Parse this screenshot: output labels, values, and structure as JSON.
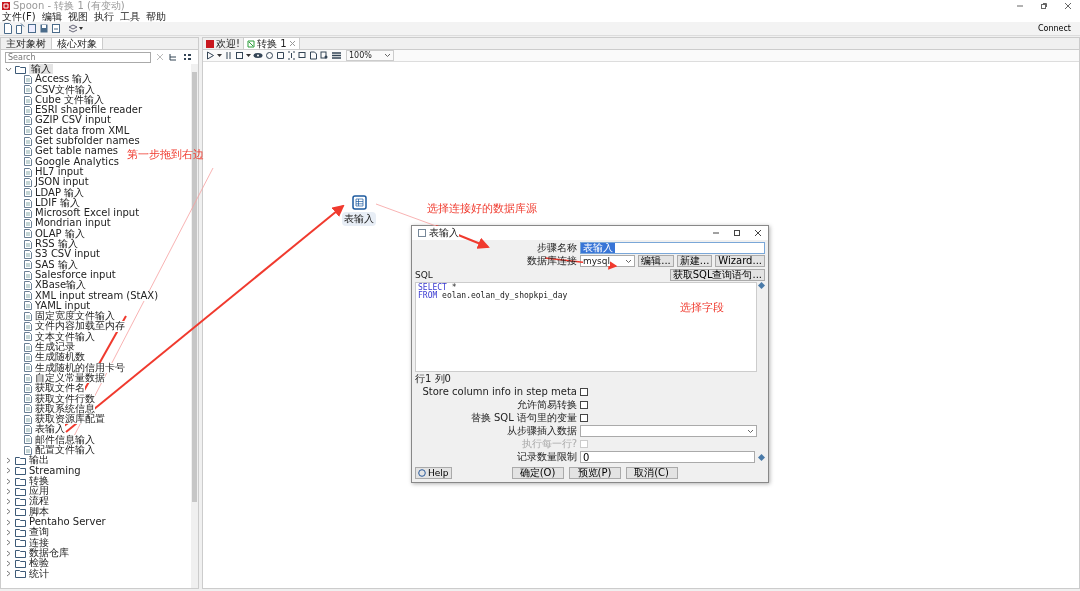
{
  "window": {
    "title": "Spoon - 转换 1 (有变动)",
    "connect_button": "Connect"
  },
  "menu": [
    "文件(F)",
    "编辑",
    "视图",
    "执行",
    "工具",
    "帮助"
  ],
  "left_tabs": [
    {
      "label": "主对象树",
      "selected": false
    },
    {
      "label": "核心对象",
      "selected": true
    }
  ],
  "search": {
    "placeholder": "Search"
  },
  "tree": [
    {
      "label": "输入",
      "expanded": true,
      "children": [
        "Access 输入",
        "CSV文件输入",
        "Cube 文件输入",
        "ESRI shapefile reader",
        "GZIP CSV input",
        "Get data from XML",
        "Get subfolder names",
        "Get table names",
        "Google Analytics",
        "HL7 input",
        "JSON input",
        "LDAP 输入",
        "LDIF 输入",
        "Microsoft Excel input",
        "Mondrian input",
        "OLAP 输入",
        "RSS 输入",
        "S3 CSV input",
        "SAS 输入",
        "Salesforce input",
        "XBase输入",
        "XML input stream (StAX)",
        "YAML input",
        "固定宽度文件输入",
        "文件内容加载至内存",
        "文本文件输入",
        "生成记录",
        "生成随机数",
        "生成随机的信用卡号",
        "自定义常量数据",
        "获取文件名",
        "获取文件行数",
        "获取系统信息",
        "获取资源库配置",
        "表输入",
        "邮件信息输入",
        "配置文件输入"
      ]
    },
    {
      "label": "输出",
      "expanded": false
    },
    {
      "label": "Streaming",
      "expanded": false
    },
    {
      "label": "转换",
      "expanded": false
    },
    {
      "label": "应用",
      "expanded": false
    },
    {
      "label": "流程",
      "expanded": false
    },
    {
      "label": "脚本",
      "expanded": false
    },
    {
      "label": "Pentaho Server",
      "expanded": false
    },
    {
      "label": "查询",
      "expanded": false
    },
    {
      "label": "连接",
      "expanded": false
    },
    {
      "label": "数据仓库",
      "expanded": false
    },
    {
      "label": "检验",
      "expanded": false
    },
    {
      "label": "统计",
      "expanded": false
    }
  ],
  "editor_tabs": [
    {
      "label": "欢迎!",
      "selected": false
    },
    {
      "label": "转换 1",
      "selected": true
    }
  ],
  "zoom": "100%",
  "canvas_node": {
    "label": "表输入"
  },
  "dialog": {
    "title": "表输入",
    "step_name_label": "步骤名称",
    "step_name": "表输入",
    "connection_label": "数据库连接",
    "connection": "mysql",
    "connection_buttons": [
      "编辑...",
      "新建...",
      "Wizard..."
    ],
    "sql_label": "SQL",
    "get_sql_button": "获取SQL查询语句...",
    "sql_lines": [
      {
        "keyword": "SELECT",
        "rest": " *"
      },
      {
        "keyword": "FROM",
        "rest": " eolan.eolan_dy_shopkpi_day"
      }
    ],
    "cursor_position": "行1 列0",
    "options": [
      {
        "label": "Store column info in step meta",
        "checked": false
      },
      {
        "label": "允许简易转换",
        "checked": false
      },
      {
        "label": "替换 SQL 语句里的变量",
        "checked": false
      }
    ],
    "insert_from_step_label": "从步骤插入数据",
    "execute_each_row": {
      "label": "执行每一行?",
      "checked": false,
      "disabled": true
    },
    "limit_label": "记录数量限制",
    "limit": "0",
    "help_button": "Help",
    "footer_buttons": [
      "确定(O)",
      "预览(P)",
      "取消(C)"
    ]
  },
  "annotations": [
    "第一步拖到右边",
    "选择连接好的数据库源",
    "选择字段"
  ]
}
